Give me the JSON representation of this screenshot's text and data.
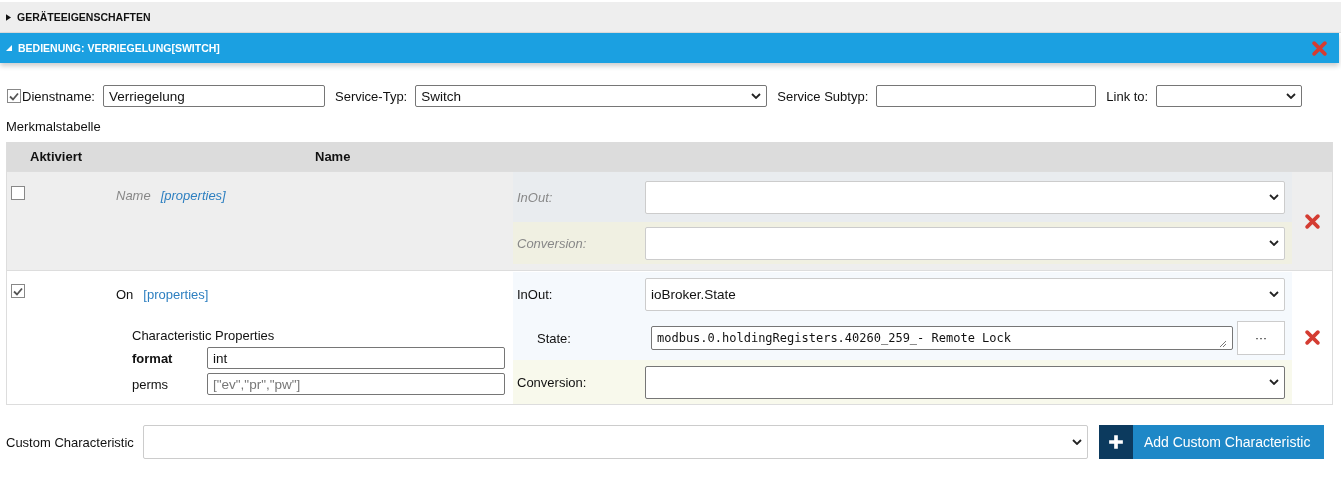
{
  "device_panel": {
    "title": "GERÄTEEIGENSCHAFTEN",
    "expanded": false
  },
  "service_panel": {
    "title": "BEDIENUNG: VERRIEGELUNG[SWITCH]",
    "expanded": true
  },
  "service": {
    "enabled": true,
    "name_label": "Dienstname:",
    "name": "Verriegelung",
    "type_label": "Service-Typ:",
    "type": "Switch",
    "subtype_label": "Service Subtyp:",
    "link_label": "Link to:"
  },
  "table": {
    "title": "Merkmalstabelle",
    "columns": [
      "Aktiviert",
      "Name"
    ],
    "rows": [
      {
        "name": "Name",
        "link": "[properties]",
        "enabled": false,
        "fields": [
          {
            "kind": "inout",
            "label": "InOut:"
          },
          {
            "kind": "conversion",
            "label": "Conversion:"
          }
        ]
      },
      {
        "name": "On",
        "link": "[properties]",
        "enabled": true,
        "properties": {
          "title": "Characteristic Properties",
          "items": [
            {
              "label": "format",
              "value": "int",
              "bold": true
            },
            {
              "label": "perms",
              "placeholder": "[\"ev\",\"pr\",\"pw\"]",
              "bold": false
            }
          ]
        },
        "fields": [
          {
            "kind": "inout",
            "label": "InOut:",
            "value": "ioBroker.State"
          },
          {
            "kind": "state",
            "label": "State:",
            "value": "modbus.0.holdingRegisters.40260_259_- Remote Lock",
            "button": "···"
          },
          {
            "kind": "conversion",
            "label": "Conversion:"
          }
        ]
      }
    ]
  },
  "custom": {
    "label": "Custom Characteristic",
    "button": "Add Custom Characteristic"
  }
}
